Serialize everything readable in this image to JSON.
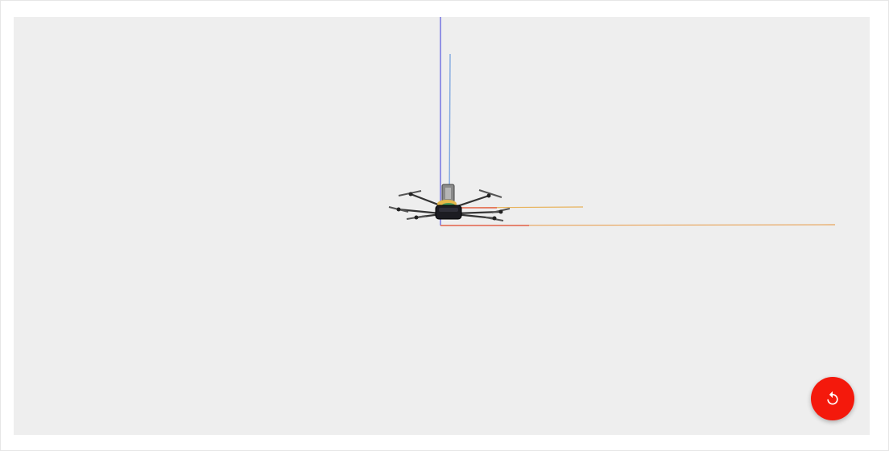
{
  "viewport": {
    "background_color": "#eeeeee",
    "content": "3d-drone-model-view"
  },
  "axes": {
    "x_color": "#e1503c",
    "y_color": "#e8b25a",
    "z_color": "#6a6ae0",
    "z2_color": "#7fa8e0"
  },
  "reset_button": {
    "icon": "reset-icon",
    "color": "#f4190c"
  }
}
